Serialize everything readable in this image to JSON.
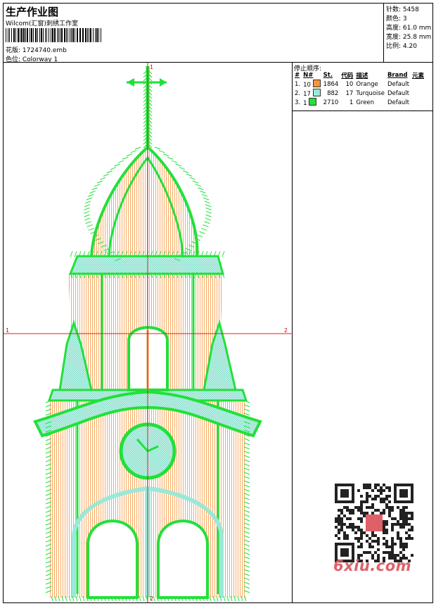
{
  "header": {
    "title": "生产作业图",
    "company": "Wilcom(汇窗)刺绣工作室",
    "design_label": "花版: 1724740.emb",
    "colorway_label": "色位: Colorway 1"
  },
  "stats": {
    "stitches": "针数: 5458",
    "colors": "颜色: 3",
    "height": "高度: 61.0 mm",
    "width": "宽度: 25.8 mm",
    "scale": "比例: 4.20"
  },
  "axes": {
    "x_left": "1",
    "x_right": "2",
    "y_top": "1",
    "y_bottom": "2"
  },
  "stop_sequence": {
    "title": "停止顺序:",
    "headers": [
      "#",
      "N#",
      "St.",
      "代码",
      "描述",
      "Brand",
      "元素"
    ],
    "rows": [
      {
        "num": "1.",
        "needle": "10",
        "stitches": "1864",
        "code": "10",
        "desc": "Orange",
        "brand": "Default",
        "color": "#f5943c"
      },
      {
        "num": "2.",
        "needle": "17",
        "stitches": "882",
        "code": "17",
        "desc": "Turquoise",
        "brand": "Default",
        "color": "#9ae8d8"
      },
      {
        "num": "3.",
        "needle": "1",
        "stitches": "2710",
        "code": "1",
        "desc": "Green",
        "brand": "Default",
        "color": "#22e03a"
      }
    ]
  },
  "watermark": {
    "site": "6xiu.com"
  },
  "colors": {
    "orange": "#f5943c",
    "turquoise": "#9ae8d8",
    "green": "#22e03a",
    "guide": "#d0281e"
  }
}
